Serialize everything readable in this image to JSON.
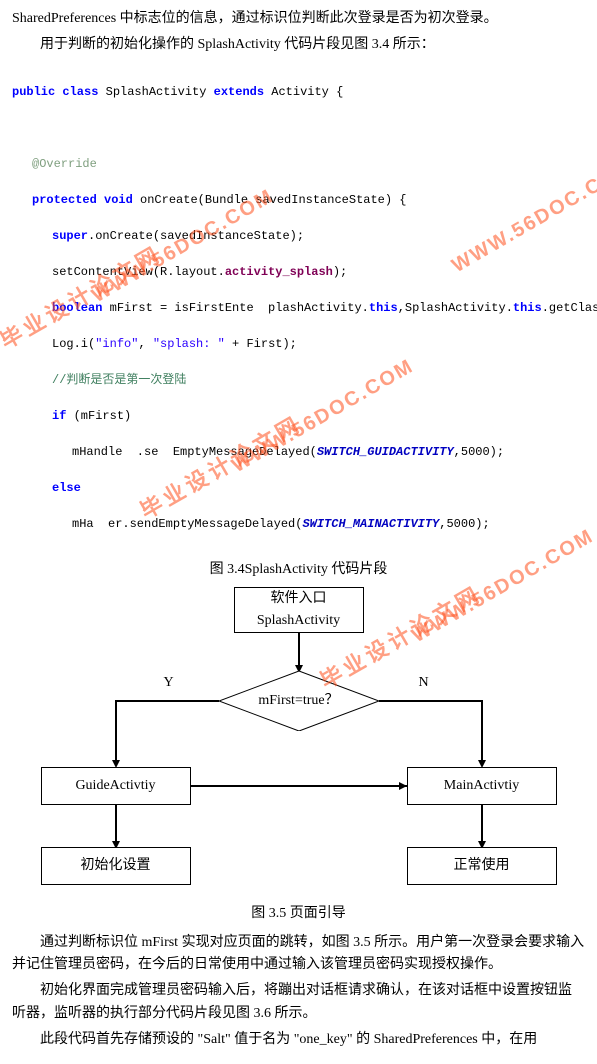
{
  "text": {
    "p1": "SharedPreferences 中标志位的信息，通过标识位判断此次登录是否为初次登录。",
    "p2": "用于判断的初始化操作的 SplashActivity 代码片段见图 3.4 所示：",
    "code": {
      "l1a": "public class",
      "l1b": " SplashActivity ",
      "l1c": "extends",
      "l1d": " Activity {",
      "l2": "@Override",
      "l3a": "protected void",
      "l3b": " onCreate(Bundle savedInstanceState) {",
      "l4a": "super",
      "l4b": ".onCreate(savedInstanceState);",
      "l5a": "setContentView(R.layout.",
      "l5b": "activity_splash",
      "l5c": ");",
      "l6a": "boolean",
      "l6b": " mFirst = isFirstEnte  plashActivity.",
      "l6c": "this",
      "l6d": ",SplashActivity.",
      "l6e": "this",
      "l6f": ".getClass().getName());",
      "l7a": "Log.i(",
      "l7b": "\"info\"",
      "l7c": ", ",
      "l7d": "\"splash: \"",
      "l7e": " + First);",
      "l8": "//判断是否是第一次登陆",
      "l9a": "if",
      "l9b": " (mFirst)",
      "l10a": "mHandle  .se  EmptyMessageDelayed(",
      "l10b": "SWITCH_GUIDACTIVITY",
      "l10c": ",5000);",
      "l11": "else",
      "l12a": "mHa  er.sendEmptyMessageDelayed(",
      "l12b": "SWITCH_MAINACTIVITY",
      "l12c": ",5000);"
    },
    "caption1": "图 3.4SplashActivity 代码片段",
    "caption2": "图 3.5 页面引导",
    "p3": "通过判断标识位 mFirst 实现对应页面的跳转，如图 3.5 所示。用户第一次登录会要求输入并记住管理员密码，在今后的日常使用中通过输入该管理员密码实现授权操作。",
    "p4": "初始化界面完成管理员密码输入后，将蹦出对话框请求确认，在该对话框中设置按钮监听器，监听器的执行部分代码片段见图 3.6 所示。",
    "p5": "此段代码首先存储预设的 \"Salt\" 值于名为 \"one_key\" 的 SharedPreferences 中，在用"
  },
  "flow": {
    "entry_line1": "软件入口",
    "entry_line2": "SplashActivity",
    "decision": "mFirst=true？",
    "yes": "Y",
    "no": "N",
    "guide": "GuideActivtiy",
    "main": "MainActivtiy",
    "init": "初始化设置",
    "normal": "正常使用"
  },
  "watermark": {
    "url": "WWW.56DOC.COM",
    "cn": "毕业设计论文网"
  }
}
